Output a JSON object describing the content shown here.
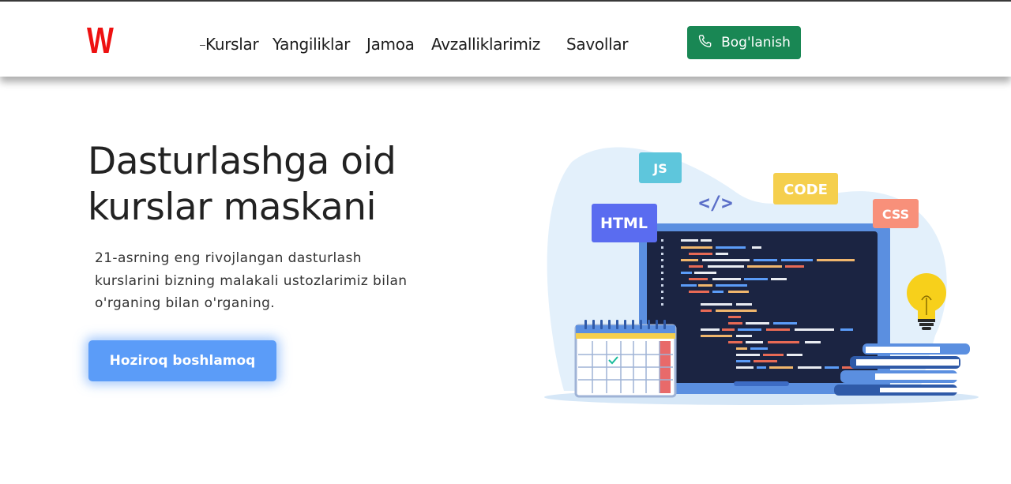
{
  "navbar": {
    "logo_text": "W",
    "links": [
      "Kurslar",
      "Yangiliklar",
      "Jamoa",
      "Avzalliklarimiz",
      "Savollar"
    ],
    "contact_label": "Bog'lanish"
  },
  "hero": {
    "title_line1": "Dasturlashga oid",
    "title_line2": "kurslar maskani",
    "text_line1": "21-asrning eng rivojlangan dasturlash",
    "text_line2": "kurslarini bizning malakali ustozlarimiz bilan",
    "text_line3": "o'rganing bilan o'rganing.",
    "cta_label": "Hoziroq boshlamoq"
  },
  "illustration": {
    "tags": {
      "js": "JS",
      "code": "CODE",
      "html": "HTML",
      "css": "CSS",
      "brackets": "</>"
    }
  },
  "colors": {
    "logo": "#ee1111",
    "contact_button": "#198754",
    "cta_button": "#5b9cf8"
  }
}
